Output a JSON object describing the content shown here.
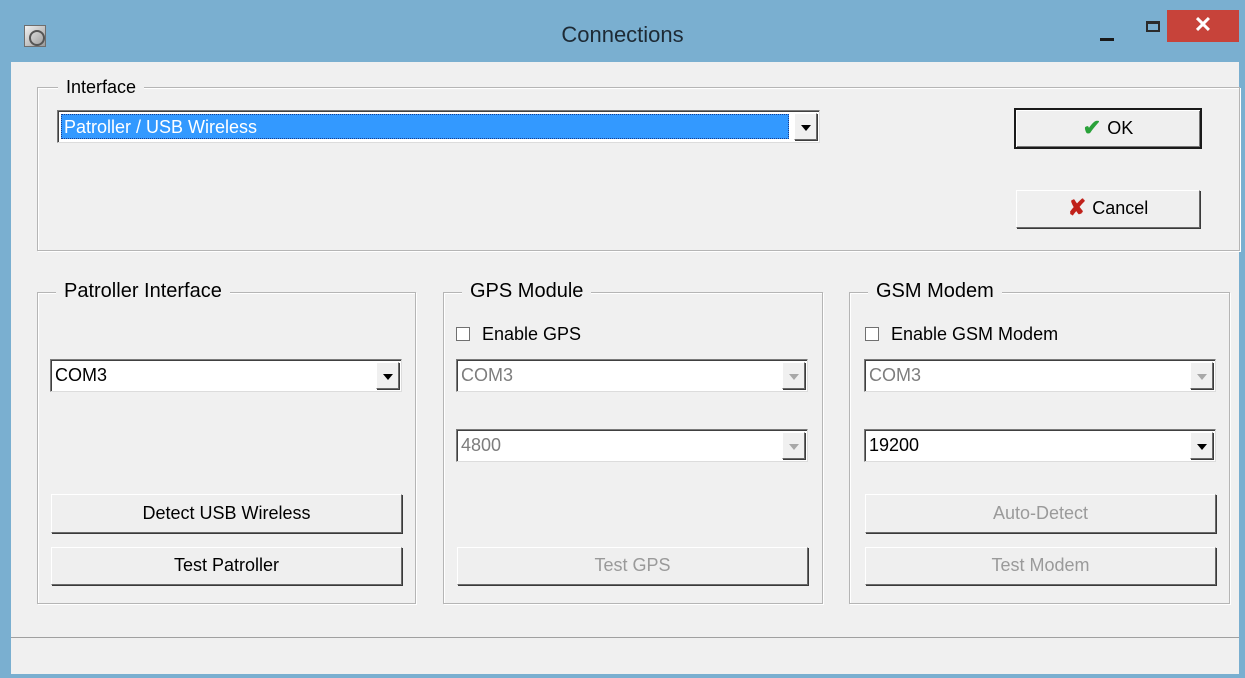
{
  "window": {
    "title": "Connections",
    "close_glyph": "✕",
    "icon": "app-icon"
  },
  "interface_group": {
    "legend": "Interface",
    "selected": "Patroller / USB Wireless"
  },
  "dialog_buttons": {
    "ok_label": "OK",
    "ok_icon": "checkmark-icon",
    "cancel_label": "Cancel",
    "cancel_icon": "x-icon"
  },
  "patroller_interface": {
    "legend": "Patroller Interface",
    "port": "COM3",
    "detect_label": "Detect USB Wireless",
    "test_label": "Test Patroller"
  },
  "gps_module": {
    "legend": "GPS Module",
    "enable_label": "Enable GPS",
    "enabled": false,
    "port": "COM3",
    "baud": "4800",
    "test_label": "Test GPS"
  },
  "gsm_modem": {
    "legend": "GSM Modem",
    "enable_label": "Enable GSM Modem",
    "enabled": false,
    "port": "COM3",
    "baud": "19200",
    "autodetect_label": "Auto-Detect",
    "test_label": "Test Modem"
  },
  "colors": {
    "titlebar": "#7aafd0",
    "close_button": "#c7433a",
    "selection": "#3399ff",
    "ok_check": "#2aa23a",
    "cancel_x": "#c0211a"
  }
}
